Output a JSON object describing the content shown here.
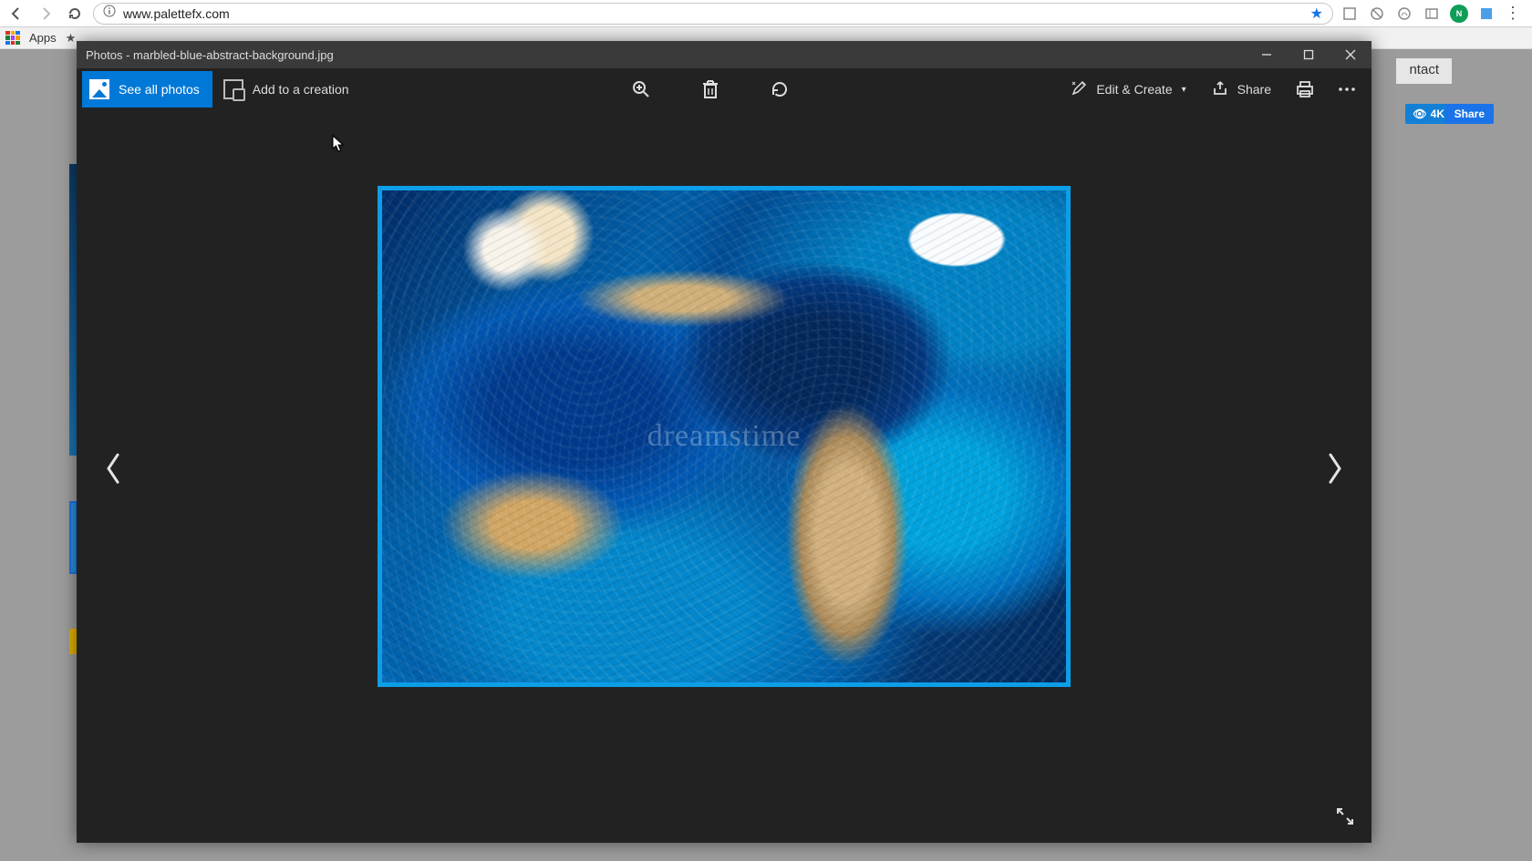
{
  "browser": {
    "url": "www.palettefx.com",
    "apps_label": "Apps"
  },
  "site": {
    "contact_tab": "ntact",
    "badge_text": "4K",
    "share_text": "Share"
  },
  "photos": {
    "title": "Photos - marbled-blue-abstract-background.jpg",
    "see_all": "See all photos",
    "add_creation": "Add to a creation",
    "edit_create": "Edit & Create",
    "share": "Share",
    "watermark": "dreamstime"
  }
}
